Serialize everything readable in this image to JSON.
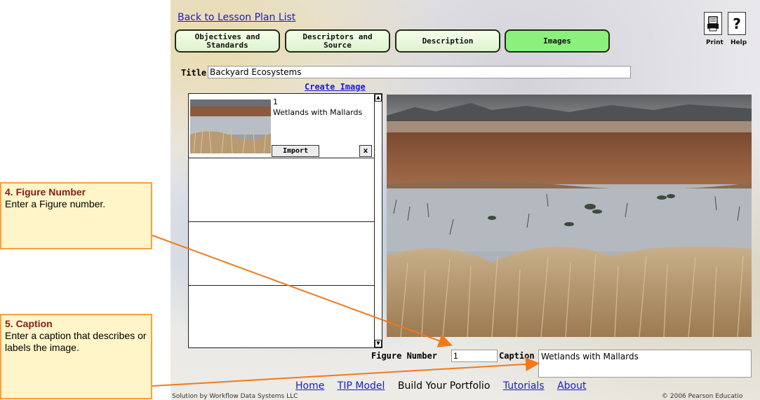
{
  "header": {
    "back_link": "Back to Lesson Plan List",
    "tabs": [
      {
        "label": "Objectives and\nStandards",
        "active": false
      },
      {
        "label": "Descriptors and\nSource",
        "active": false
      },
      {
        "label": "Description",
        "active": false
      },
      {
        "label": "Images",
        "active": true
      }
    ],
    "print_label": "Print",
    "help_label": "Help"
  },
  "title_field": {
    "label": "Title:",
    "value": "Backyard Ecosystems"
  },
  "create_image_link": "Create Image",
  "image_list": {
    "items": [
      {
        "number": "1",
        "caption": "Wetlands with Mallards",
        "import_label": "Import",
        "delete_label": "x"
      }
    ]
  },
  "figure_number": {
    "label": "Figure Number",
    "value": "1"
  },
  "caption": {
    "label": "Caption",
    "value": "Wetlands with Mallards"
  },
  "footer": {
    "nav": [
      "Home",
      "TIP Model",
      "Build Your Portfolio",
      "Tutorials",
      "About"
    ],
    "solution": "Solution by Workflow Data Systems LLC",
    "copyright": "© 2006 Pearson Educatio"
  },
  "callouts": {
    "figure": {
      "title": "4. Figure Number",
      "body": "Enter a Figure number."
    },
    "caption": {
      "title": "5. Caption",
      "body": "Enter a caption that describes or labels the image."
    }
  },
  "colors": {
    "active_tab": "#8cf07d",
    "tab": "#e4f6d6",
    "link": "#1a1ad0",
    "callout_border": "#f7a046",
    "callout_fill": "#fff5c8",
    "arrow": "#f07a1a"
  }
}
